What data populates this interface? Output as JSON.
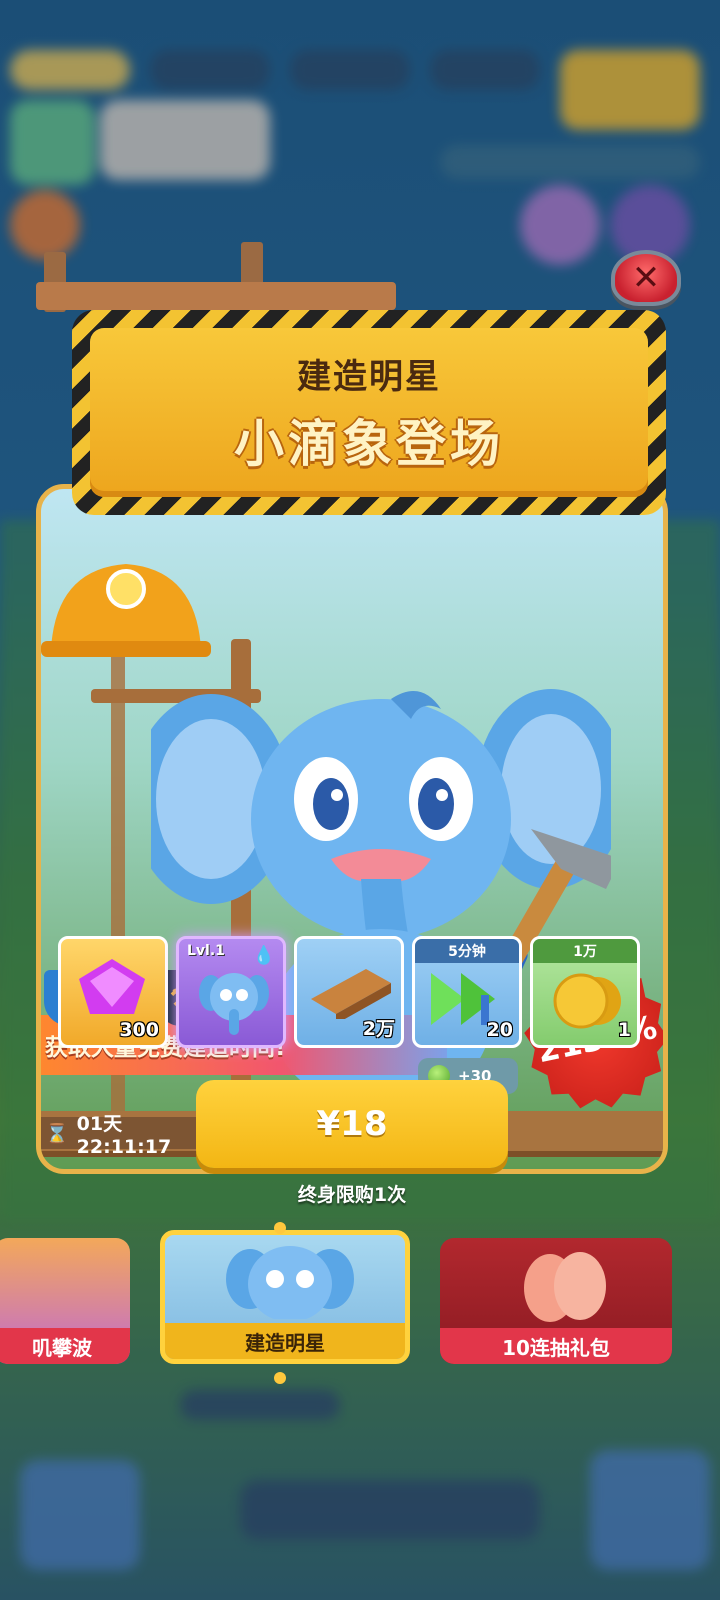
{
  "offer": {
    "title_small": "建造明星",
    "title_big": "小滴象登场",
    "promo_text": "获取大量免费建造时间!",
    "percent": "2134%",
    "timer": "01天 22:11:17",
    "price": "¥18",
    "bonus": "+30",
    "limit": "终身限购1次"
  },
  "rewards": [
    {
      "name": "gem",
      "amount": "300"
    },
    {
      "name": "character",
      "level": "Lvl.1",
      "amount": ""
    },
    {
      "name": "wood",
      "amount": "2万"
    },
    {
      "name": "speedup",
      "tag": "5分钟",
      "amount": "20"
    },
    {
      "name": "coins",
      "tag": "1万",
      "amount": "1"
    }
  ],
  "carousel": {
    "left_partial": "叽攀波",
    "center": "建造明星",
    "right": "10连抽礼包"
  },
  "colors": {
    "accent": "#f3b614",
    "badge": "#e0302a",
    "card_border": "#e8b34a"
  }
}
